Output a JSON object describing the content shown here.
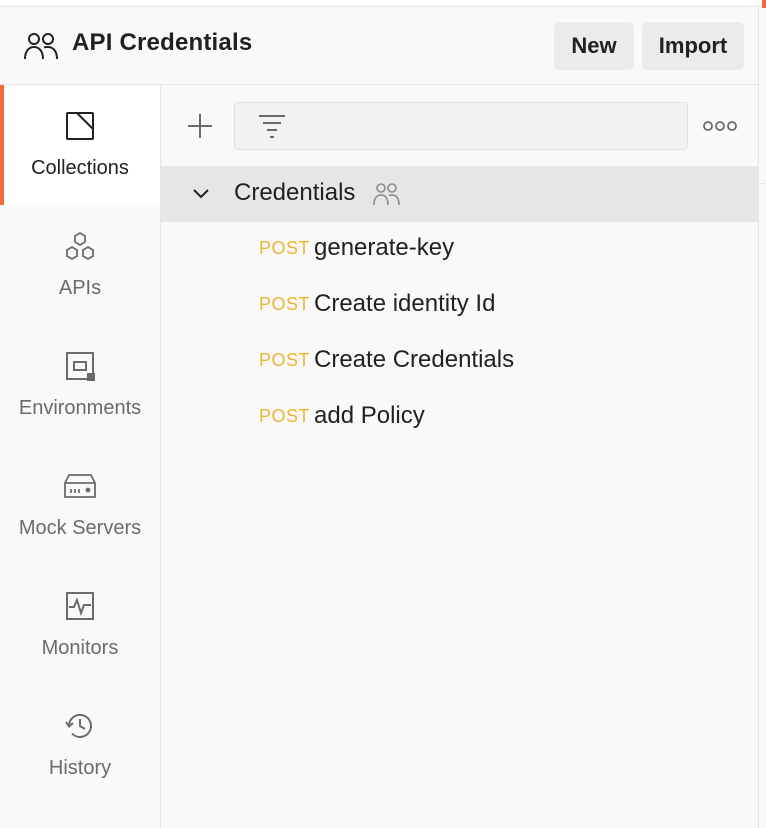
{
  "workspace": {
    "title": "API Credentials",
    "icon": "team-icon",
    "new_label": "New",
    "import_label": "Import"
  },
  "sidebar": {
    "items": [
      {
        "label": "Collections",
        "icon": "collections-icon",
        "active": true
      },
      {
        "label": "APIs",
        "icon": "apis-icon"
      },
      {
        "label": "Environments",
        "icon": "environments-icon"
      },
      {
        "label": "Mock Servers",
        "icon": "mock-servers-icon"
      },
      {
        "label": "Monitors",
        "icon": "monitors-icon"
      },
      {
        "label": "History",
        "icon": "history-icon"
      }
    ]
  },
  "toolbar": {
    "add_icon": "plus-icon",
    "filter_icon": "filter-icon",
    "filter_value": "",
    "more_icon": "more-icon"
  },
  "collection": {
    "name": "Credentials",
    "expanded": true,
    "shared_icon": "team-icon",
    "requests": [
      {
        "method": "POST",
        "name": "generate-key"
      },
      {
        "method": "POST",
        "name": "Create identity Id"
      },
      {
        "method": "POST",
        "name": "Create Credentials"
      },
      {
        "method": "POST",
        "name": "add Policy"
      }
    ]
  },
  "colors": {
    "accent": "#f26b3a",
    "post_method": "#eeb433",
    "selected_row": "#e6e6e6"
  }
}
